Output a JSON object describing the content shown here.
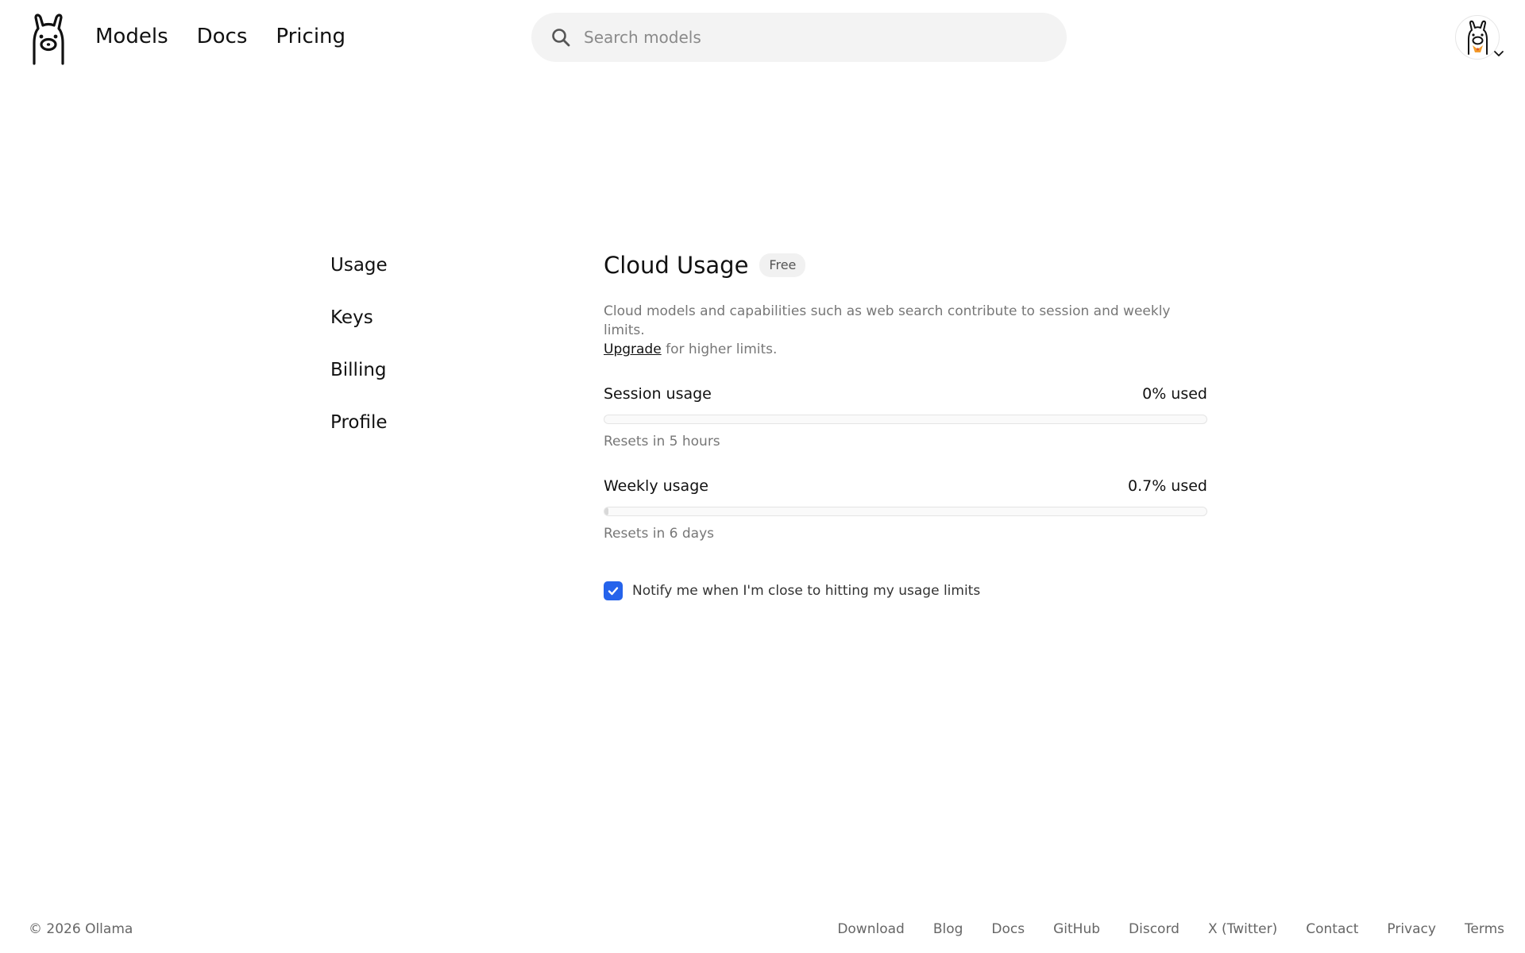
{
  "header": {
    "nav": [
      "Models",
      "Docs",
      "Pricing"
    ],
    "search_placeholder": "Search models"
  },
  "sidebar": {
    "items": [
      {
        "label": "Usage"
      },
      {
        "label": "Keys"
      },
      {
        "label": "Billing"
      },
      {
        "label": "Profile"
      }
    ]
  },
  "main": {
    "title": "Cloud Usage",
    "plan_badge": "Free",
    "description": "Cloud models and capabilities such as web search contribute to session and weekly limits.",
    "upgrade_link": "Upgrade",
    "upgrade_suffix": " for higher limits.",
    "session": {
      "label": "Session usage",
      "value": "0% used",
      "percent": 0,
      "reset": "Resets in 5 hours"
    },
    "weekly": {
      "label": "Weekly usage",
      "value": "0.7% used",
      "percent": 0.7,
      "reset": "Resets in 6 days"
    },
    "notify": {
      "checked": true,
      "label": "Notify me when I'm close to hitting my usage limits"
    }
  },
  "footer": {
    "copyright": "© 2026 Ollama",
    "links": [
      "Download",
      "Blog",
      "Docs",
      "GitHub",
      "Discord",
      "X (Twitter)",
      "Contact",
      "Privacy",
      "Terms"
    ]
  },
  "colors": {
    "accent": "#2563eb",
    "muted_text": "#777777",
    "search_bg": "#f3f3f3"
  },
  "icons": {
    "logo": "llama-logo-icon",
    "search": "search-icon",
    "avatar": "llama-avatar-icon",
    "caret": "chevron-down-icon",
    "check": "checkmark-icon"
  }
}
